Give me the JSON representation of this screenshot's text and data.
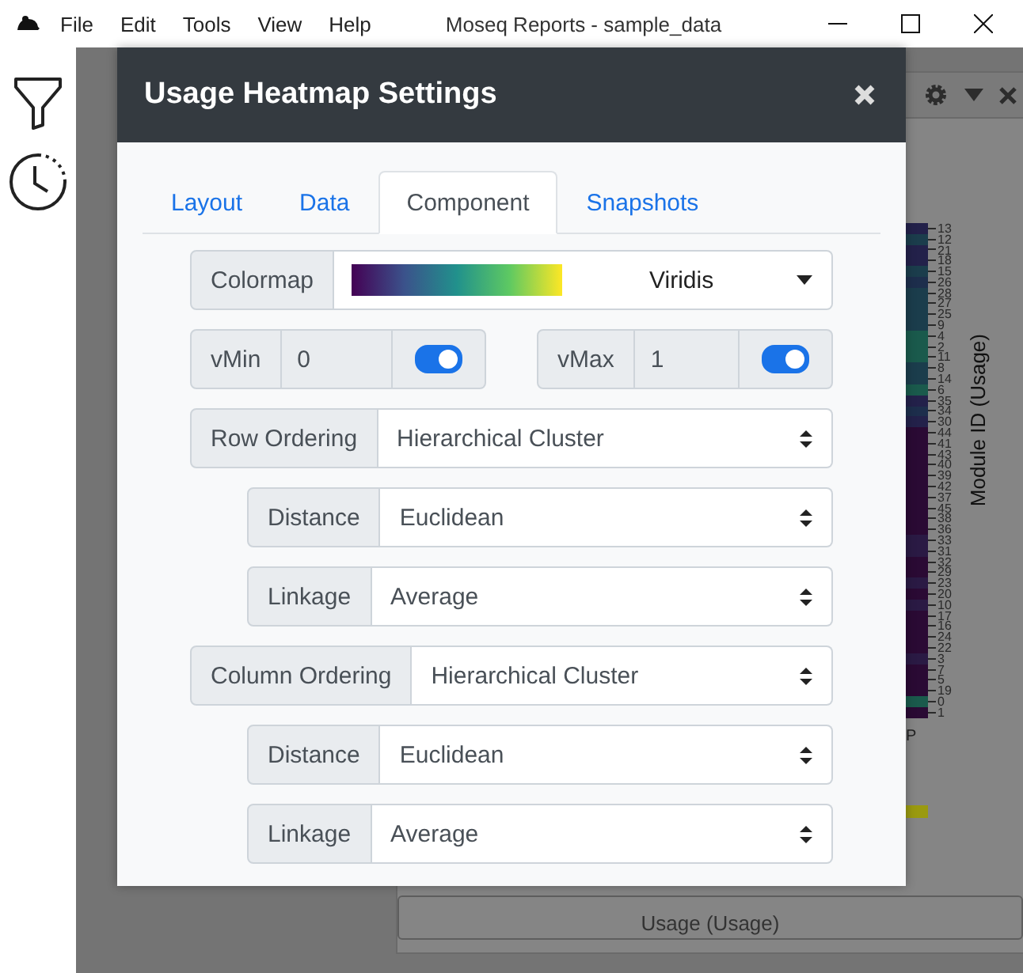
{
  "app_window": {
    "title": "Moseq Reports - sample_data",
    "menu": [
      "File",
      "Edit",
      "Tools",
      "View",
      "Help"
    ]
  },
  "heatmap": {
    "row_labels": [
      "13",
      "12",
      "21",
      "18",
      "15",
      "26",
      "28",
      "27",
      "25",
      "9",
      "4",
      "2",
      "11",
      "8",
      "14",
      "6",
      "35",
      "34",
      "30",
      "44",
      "41",
      "43",
      "40",
      "39",
      "42",
      "37",
      "45",
      "38",
      "36",
      "33",
      "31",
      "32",
      "29",
      "23",
      "20",
      "10",
      "17",
      "16",
      "24",
      "22",
      "3",
      "7",
      "5",
      "19",
      "0",
      "1"
    ],
    "axis_title": "Module ID (Usage)",
    "legend_fragment": "P",
    "x_axis_title": "Usage (Usage)"
  },
  "dialog": {
    "title": "Usage Heatmap Settings",
    "tabs": [
      {
        "label": "Layout",
        "selected": false
      },
      {
        "label": "Data",
        "selected": false
      },
      {
        "label": "Component",
        "selected": true
      },
      {
        "label": "Snapshots",
        "selected": false
      }
    ],
    "colormap": {
      "label": "Colormap",
      "value": "Viridis"
    },
    "ranges": [
      {
        "label": "vMin",
        "value": "0",
        "on": true
      },
      {
        "label": "vMax",
        "value": "1",
        "on": true
      }
    ],
    "orderings": [
      {
        "label": "Row Ordering",
        "value": "Hierarchical Cluster",
        "options": [
          {
            "label": "Distance",
            "value": "Euclidean"
          },
          {
            "label": "Linkage",
            "value": "Average"
          }
        ]
      },
      {
        "label": "Column Ordering",
        "value": "Hierarchical Cluster",
        "options": [
          {
            "label": "Distance",
            "value": "Euclidean"
          },
          {
            "label": "Linkage",
            "value": "Average"
          }
        ]
      }
    ]
  }
}
